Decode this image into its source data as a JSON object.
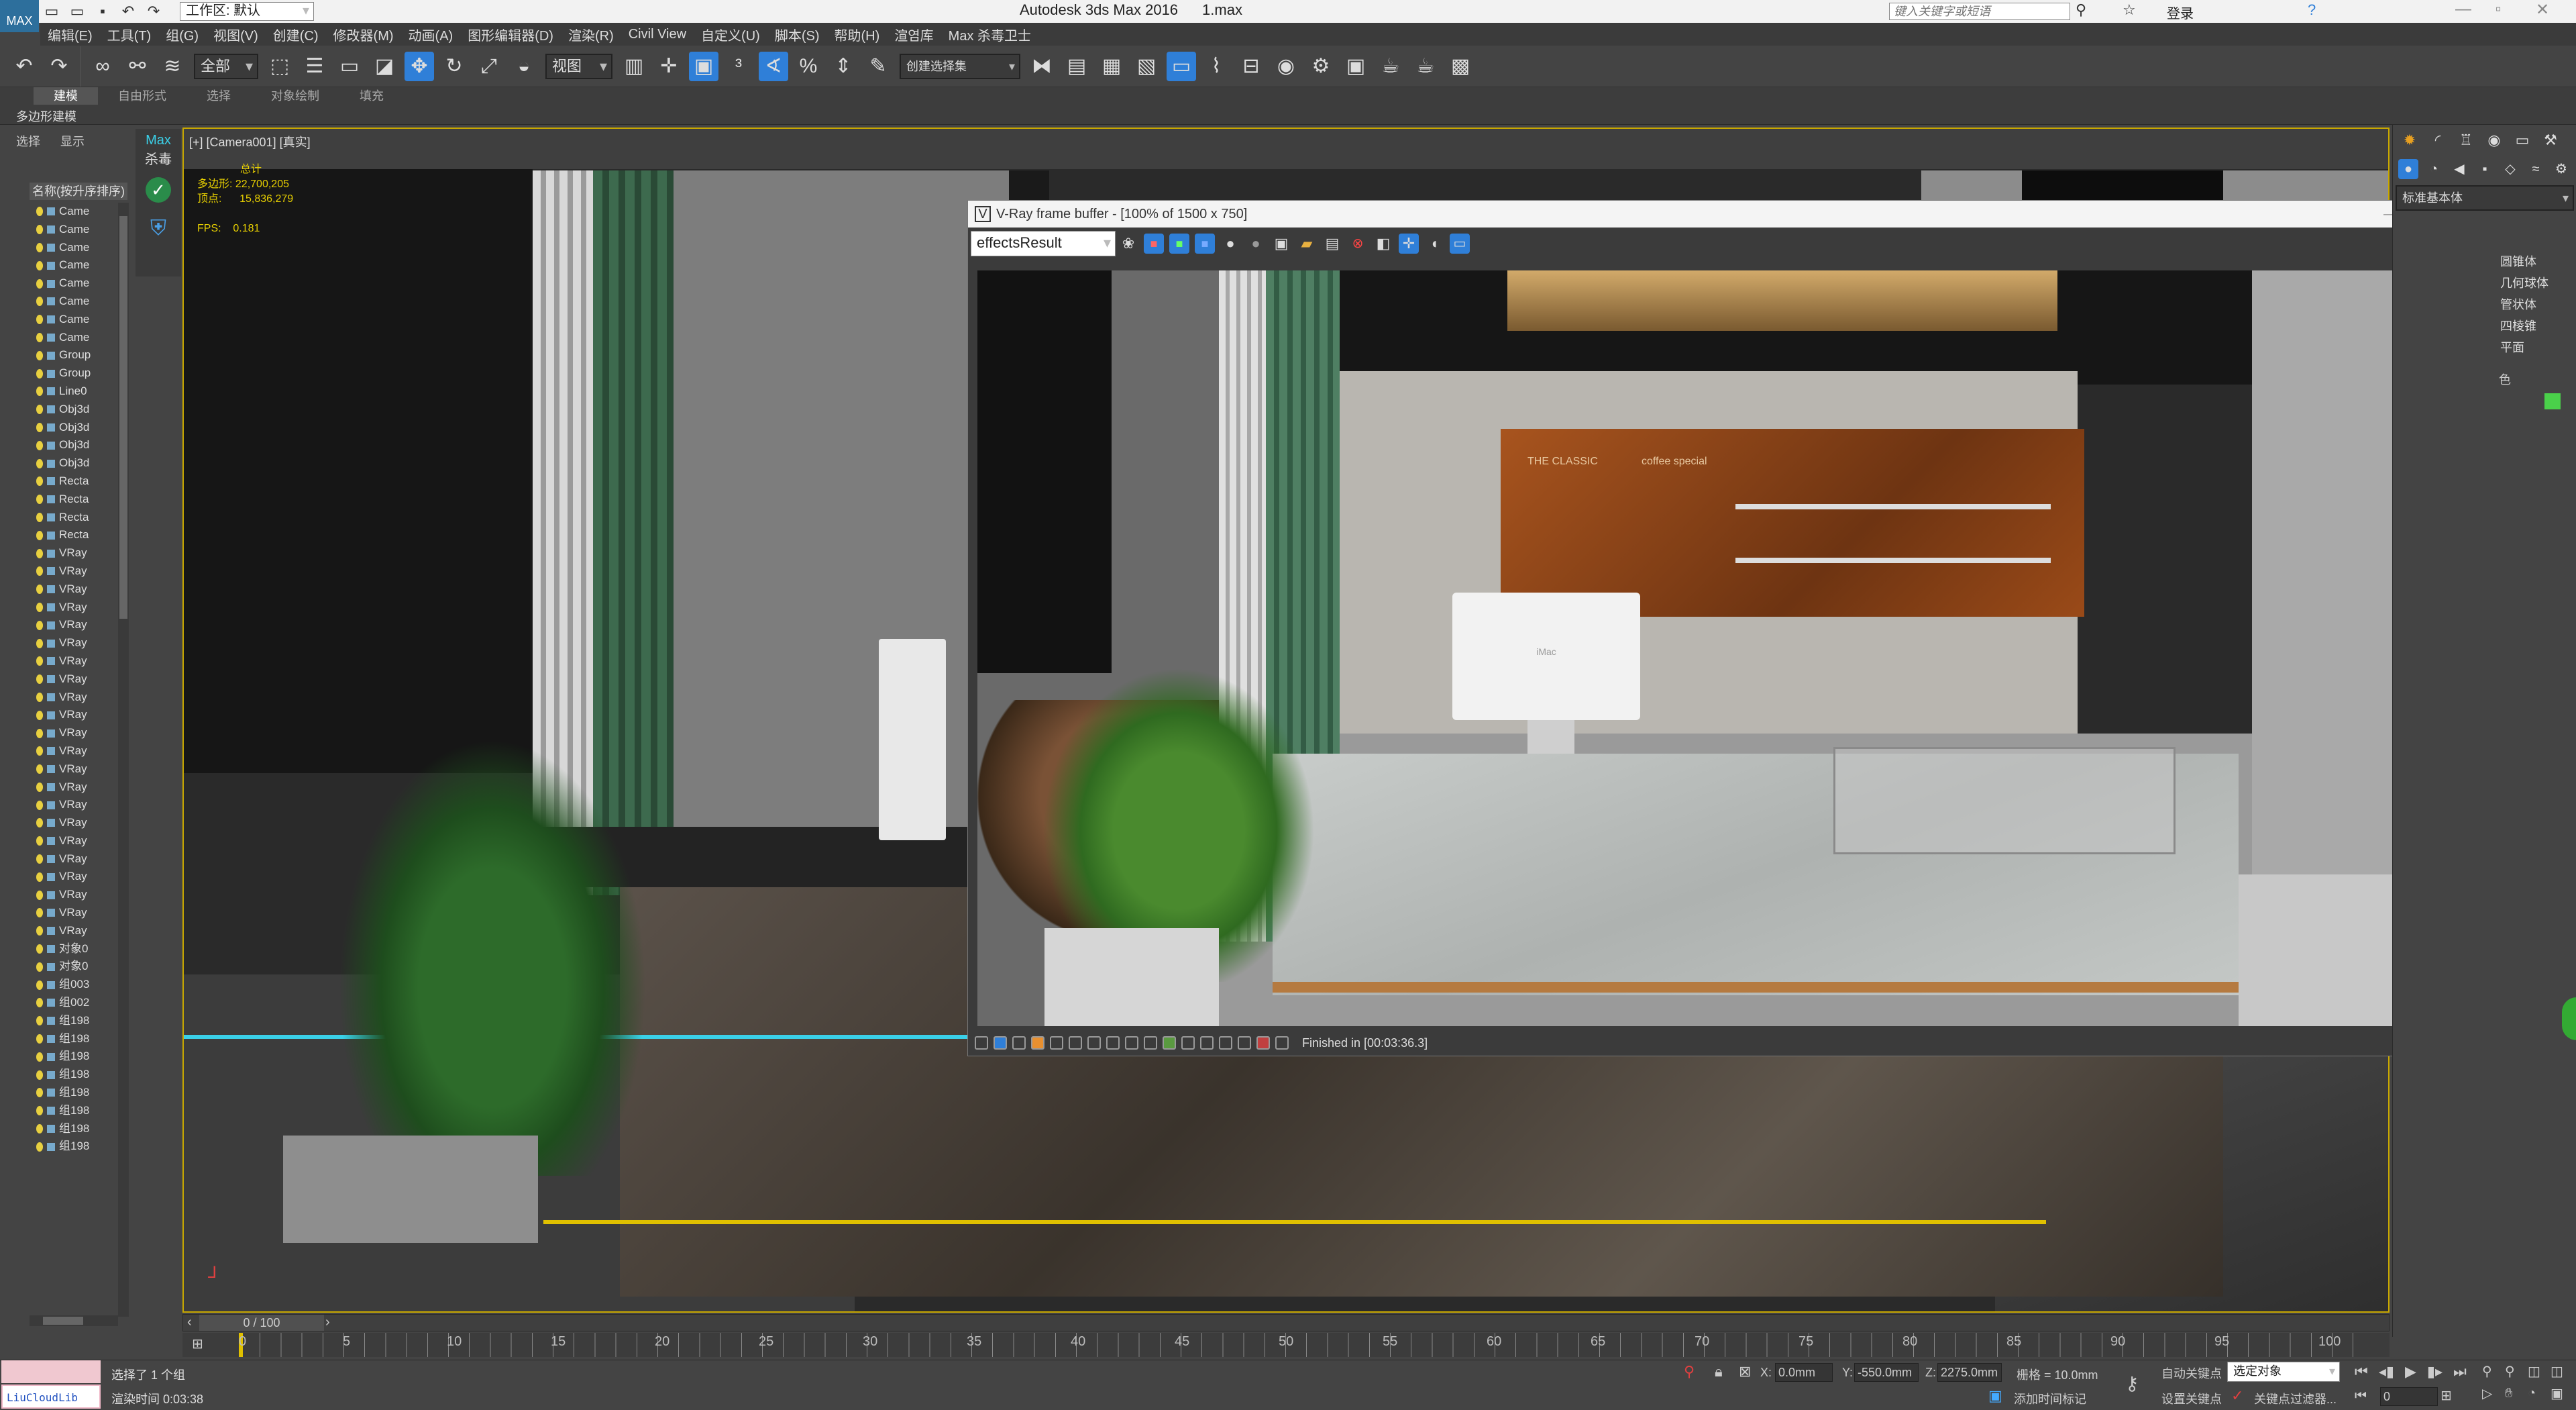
{
  "app": {
    "title": "Autodesk 3ds Max 2016",
    "file": "1.max",
    "workspace": "工作区: 默认",
    "search_placeholder": "键入关键字或短语",
    "login": "登录"
  },
  "menu": [
    "编辑(E)",
    "工具(T)",
    "组(G)",
    "视图(V)",
    "创建(C)",
    "修改器(M)",
    "动画(A)",
    "图形编辑器(D)",
    "渲染(R)",
    "Civil View",
    "自定义(U)",
    "脚本(S)",
    "帮助(H)",
    "渲염库",
    "Max 杀毒卫士"
  ],
  "toolbar": {
    "filter": "全部",
    "coord": "视图",
    "selset": "创建选择集"
  },
  "ribbon": {
    "tabs": [
      "建模",
      "自由形式",
      "选择",
      "对象绘制",
      "填充"
    ],
    "subtitle": "多边形建模"
  },
  "explorer": {
    "tabs": [
      "选择",
      "显示"
    ],
    "header": "名称(按升序排序)",
    "items": [
      "Came",
      "Came",
      "Came",
      "Came",
      "Came",
      "Came",
      "Came",
      "Came",
      "Group",
      "Group",
      "Line0",
      "Obj3d",
      "Obj3d",
      "Obj3d",
      "Obj3d",
      "Recta",
      "Recta",
      "Recta",
      "Recta",
      "VRay",
      "VRay",
      "VRay",
      "VRay",
      "VRay",
      "VRay",
      "VRay",
      "VRay",
      "VRay",
      "VRay",
      "VRay",
      "VRay",
      "VRay",
      "VRay",
      "VRay",
      "VRay",
      "VRay",
      "VRay",
      "VRay",
      "VRay",
      "VRay",
      "VRay",
      "对象0",
      "对象0",
      "组003",
      "组002",
      "组198",
      "组198",
      "组198",
      "组198",
      "组198",
      "组198",
      "组198",
      "组198"
    ]
  },
  "antivirus": {
    "line1": "Max",
    "line2": "杀毒"
  },
  "viewport": {
    "label": "[+] [Camera001] [真实]",
    "stats_title": "总计",
    "poly_label": "多边形:",
    "poly_value": "22,700,205",
    "vert_label": "顶点:",
    "vert_value": "15,836,279",
    "fps_label": "FPS:",
    "fps_value": "0.181"
  },
  "vfb": {
    "title": "V-Ray frame buffer - [100% of 1500 x 750]",
    "channel": "effectsResult",
    "status": "Finished in [00:03:36.3]"
  },
  "menu_board": {
    "title": "THE CLASSIC",
    "subtitle": "coffee special"
  },
  "monitor": {
    "brand": "iMac"
  },
  "cmd_panel": {
    "object_type": "标准基本体",
    "items": [
      "圆锥体",
      "几何球体",
      "管状体",
      "四棱锥",
      "平面"
    ],
    "color_label": "色"
  },
  "timeline": {
    "position": "0 / 100",
    "ticks": [
      "0",
      "5",
      "10",
      "15",
      "20",
      "25",
      "30",
      "35",
      "40",
      "45",
      "50",
      "55",
      "60",
      "65",
      "70",
      "75",
      "80",
      "85",
      "90",
      "95",
      "100"
    ]
  },
  "status": {
    "selection": "选择了 1 个组",
    "render_time": "渲染时间 0:03:38",
    "badge": "LiuCloudLib",
    "x_label": "X:",
    "x_value": "0.0mm",
    "y_label": "Y:",
    "y_value": "-550.0mm",
    "z_label": "Z:",
    "z_value": "2275.0mm",
    "grid": "栅格 = 10.0mm",
    "add_tag": "添加时间标记",
    "autokey": "自动关键点",
    "setkey": "设置关键点",
    "selected": "选定对象",
    "keyfilter": "关键点过滤器...",
    "frame": "0"
  },
  "colors": {
    "bg": "#444444",
    "viewport_border": "#c8a800",
    "cyan": "#3ad0e8",
    "accent": "#2f7fd8"
  }
}
